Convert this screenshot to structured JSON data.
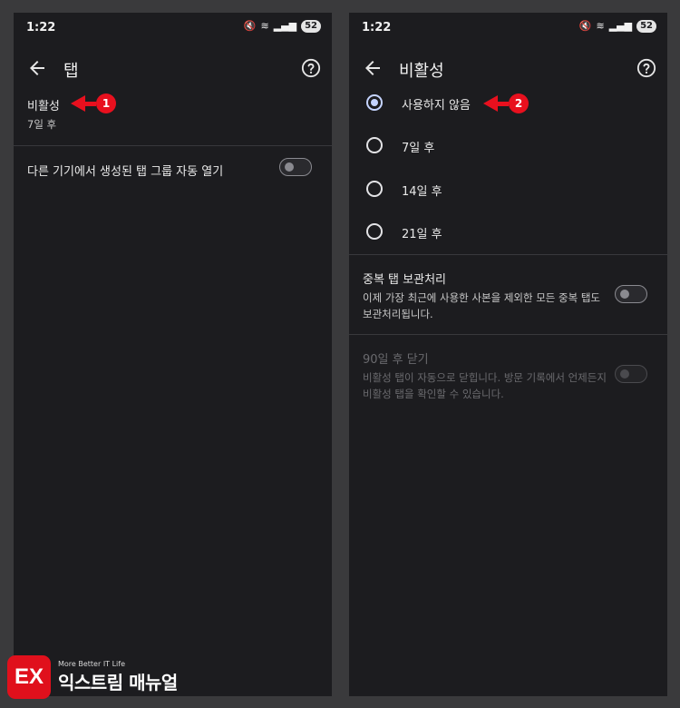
{
  "left_screen": {
    "status": {
      "time": "1:22",
      "battery": "52"
    },
    "appbar": {
      "title": "탭"
    },
    "inactive_item": {
      "title": "비활성",
      "subtitle": "7일 후"
    },
    "auto_open_item": {
      "title": "다른 기기에서 생성된 탭 그룹 자동 열기",
      "toggle_on": false
    }
  },
  "right_screen": {
    "status": {
      "time": "1:22",
      "battery": "52"
    },
    "appbar": {
      "title": "비활성"
    },
    "options": [
      {
        "label": "사용하지 않음",
        "checked": true
      },
      {
        "label": "7일 후",
        "checked": false
      },
      {
        "label": "14일 후",
        "checked": false
      },
      {
        "label": "21일 후",
        "checked": false
      }
    ],
    "duplicate_archive": {
      "title": "중복 탭 보관처리",
      "description": "이제 가장 최근에 사용한 사본을 제외한 모든 중복 탭도 보관처리됩니다.",
      "toggle_on": false
    },
    "close_after_90": {
      "title": "90일 후 닫기",
      "description": "비활성 탭이 자동으로 닫힙니다. 방문 기록에서 언제든지 비활성 탭을 확인할 수 있습니다.",
      "toggle_on": false,
      "enabled": false
    }
  },
  "annotations": {
    "step1": "1",
    "step2": "2"
  },
  "watermark": {
    "logo": "EX",
    "tagline": "More Better IT Life",
    "name": "익스트림 매뉴얼"
  },
  "colors": {
    "accent": "#e8101e",
    "radio_checked": "#c5d4ff",
    "background": "#1c1c1f"
  }
}
